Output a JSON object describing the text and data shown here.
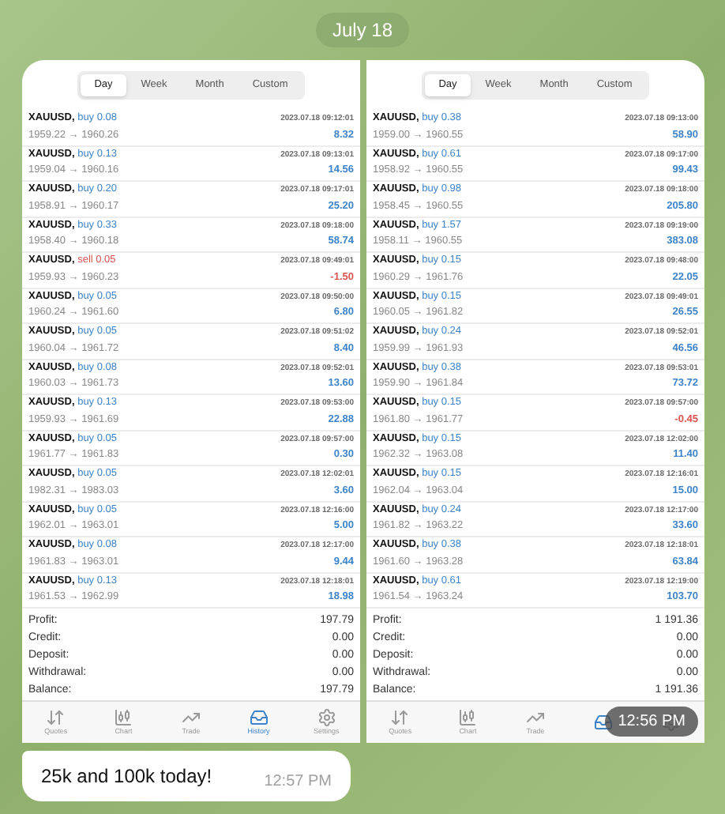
{
  "date_label": "July 18",
  "screenshots": [
    {
      "segments": [
        {
          "label": "Day",
          "selected": true
        },
        {
          "label": "Week",
          "selected": false
        },
        {
          "label": "Month",
          "selected": false
        },
        {
          "label": "Custom",
          "selected": false
        }
      ],
      "trades": [
        {
          "symbol": "XAUUSD,",
          "kind": "buy",
          "order": "buy 0.08",
          "time": "2023.07.18 09:12:01",
          "prices": "1959.22 → 1960.26",
          "profit": "8.32",
          "loss": false
        },
        {
          "symbol": "XAUUSD,",
          "kind": "buy",
          "order": "buy 0.13",
          "time": "2023.07.18 09:13:01",
          "prices": "1959.04 → 1960.16",
          "profit": "14.56",
          "loss": false
        },
        {
          "symbol": "XAUUSD,",
          "kind": "buy",
          "order": "buy 0.20",
          "time": "2023.07.18 09:17:01",
          "prices": "1958.91 → 1960.17",
          "profit": "25.20",
          "loss": false
        },
        {
          "symbol": "XAUUSD,",
          "kind": "buy",
          "order": "buy 0.33",
          "time": "2023.07.18 09:18:00",
          "prices": "1958.40 → 1960.18",
          "profit": "58.74",
          "loss": false
        },
        {
          "symbol": "XAUUSD,",
          "kind": "sell",
          "order": "sell 0.05",
          "time": "2023.07.18 09:49:01",
          "prices": "1959.93 → 1960.23",
          "profit": "-1.50",
          "loss": true
        },
        {
          "symbol": "XAUUSD,",
          "kind": "buy",
          "order": "buy 0.05",
          "time": "2023.07.18 09:50:00",
          "prices": "1960.24 → 1961.60",
          "profit": "6.80",
          "loss": false
        },
        {
          "symbol": "XAUUSD,",
          "kind": "buy",
          "order": "buy 0.05",
          "time": "2023.07.18 09:51:02",
          "prices": "1960.04 → 1961.72",
          "profit": "8.40",
          "loss": false
        },
        {
          "symbol": "XAUUSD,",
          "kind": "buy",
          "order": "buy 0.08",
          "time": "2023.07.18 09:52:01",
          "prices": "1960.03 → 1961.73",
          "profit": "13.60",
          "loss": false
        },
        {
          "symbol": "XAUUSD,",
          "kind": "buy",
          "order": "buy 0.13",
          "time": "2023.07.18 09:53:00",
          "prices": "1959.93 → 1961.69",
          "profit": "22.88",
          "loss": false
        },
        {
          "symbol": "XAUUSD,",
          "kind": "buy",
          "order": "buy 0.05",
          "time": "2023.07.18 09:57:00",
          "prices": "1961.77 → 1961.83",
          "profit": "0.30",
          "loss": false
        },
        {
          "symbol": "XAUUSD,",
          "kind": "buy",
          "order": "buy 0.05",
          "time": "2023.07.18 12:02:01",
          "prices": "1982.31 → 1983.03",
          "profit": "3.60",
          "loss": false
        },
        {
          "symbol": "XAUUSD,",
          "kind": "buy",
          "order": "buy 0.05",
          "time": "2023.07.18 12:16:00",
          "prices": "1962.01 → 1963.01",
          "profit": "5.00",
          "loss": false
        },
        {
          "symbol": "XAUUSD,",
          "kind": "buy",
          "order": "buy 0.08",
          "time": "2023.07.18 12:17:00",
          "prices": "1961.83 → 1963.01",
          "profit": "9.44",
          "loss": false
        },
        {
          "symbol": "XAUUSD,",
          "kind": "buy",
          "order": "buy 0.13",
          "time": "2023.07.18 12:18:01",
          "prices": "1961.53 → 1962.99",
          "profit": "18.98",
          "loss": false
        }
      ],
      "summary": [
        {
          "label": "Profit:",
          "value": "197.79"
        },
        {
          "label": "Credit:",
          "value": "0.00"
        },
        {
          "label": "Deposit:",
          "value": "0.00"
        },
        {
          "label": "Withdrawal:",
          "value": "0.00"
        },
        {
          "label": "Balance:",
          "value": "197.79"
        }
      ],
      "tabs": [
        {
          "label": "Quotes",
          "selected": false
        },
        {
          "label": "Chart",
          "selected": false
        },
        {
          "label": "Trade",
          "selected": false
        },
        {
          "label": "History",
          "selected": true
        },
        {
          "label": "Settings",
          "selected": false
        }
      ]
    },
    {
      "segments": [
        {
          "label": "Day",
          "selected": true
        },
        {
          "label": "Week",
          "selected": false
        },
        {
          "label": "Month",
          "selected": false
        },
        {
          "label": "Custom",
          "selected": false
        }
      ],
      "trades": [
        {
          "symbol": "XAUUSD,",
          "kind": "buy",
          "order": "buy 0.38",
          "time": "2023.07.18 09:13:00",
          "prices": "1959.00 → 1960.55",
          "profit": "58.90",
          "loss": false
        },
        {
          "symbol": "XAUUSD,",
          "kind": "buy",
          "order": "buy 0.61",
          "time": "2023.07.18 09:17:00",
          "prices": "1958.92 → 1960.55",
          "profit": "99.43",
          "loss": false
        },
        {
          "symbol": "XAUUSD,",
          "kind": "buy",
          "order": "buy 0.98",
          "time": "2023.07.18 09:18:00",
          "prices": "1958.45 → 1960.55",
          "profit": "205.80",
          "loss": false
        },
        {
          "symbol": "XAUUSD,",
          "kind": "buy",
          "order": "buy 1.57",
          "time": "2023.07.18 09:19:00",
          "prices": "1958.11 → 1960.55",
          "profit": "383.08",
          "loss": false
        },
        {
          "symbol": "XAUUSD,",
          "kind": "buy",
          "order": "buy 0.15",
          "time": "2023.07.18 09:48:00",
          "prices": "1960.29 → 1961.76",
          "profit": "22.05",
          "loss": false
        },
        {
          "symbol": "XAUUSD,",
          "kind": "buy",
          "order": "buy 0.15",
          "time": "2023.07.18 09:49:01",
          "prices": "1960.05 → 1961.82",
          "profit": "26.55",
          "loss": false
        },
        {
          "symbol": "XAUUSD,",
          "kind": "buy",
          "order": "buy 0.24",
          "time": "2023.07.18 09:52:01",
          "prices": "1959.99 → 1961.93",
          "profit": "46.56",
          "loss": false
        },
        {
          "symbol": "XAUUSD,",
          "kind": "buy",
          "order": "buy 0.38",
          "time": "2023.07.18 09:53:01",
          "prices": "1959.90 → 1961.84",
          "profit": "73.72",
          "loss": false
        },
        {
          "symbol": "XAUUSD,",
          "kind": "buy",
          "order": "buy 0.15",
          "time": "2023.07.18 09:57:00",
          "prices": "1961.80 → 1961.77",
          "profit": "-0.45",
          "loss": true
        },
        {
          "symbol": "XAUUSD,",
          "kind": "buy",
          "order": "buy 0.15",
          "time": "2023.07.18 12:02:00",
          "prices": "1962.32 → 1963.08",
          "profit": "11.40",
          "loss": false
        },
        {
          "symbol": "XAUUSD,",
          "kind": "buy",
          "order": "buy 0.15",
          "time": "2023.07.18 12:16:01",
          "prices": "1962.04 → 1963.04",
          "profit": "15.00",
          "loss": false
        },
        {
          "symbol": "XAUUSD,",
          "kind": "buy",
          "order": "buy 0.24",
          "time": "2023.07.18 12:17:00",
          "prices": "1961.82 → 1963.22",
          "profit": "33.60",
          "loss": false
        },
        {
          "symbol": "XAUUSD,",
          "kind": "buy",
          "order": "buy 0.38",
          "time": "2023.07.18 12:18:01",
          "prices": "1961.60 → 1963.28",
          "profit": "63.84",
          "loss": false
        },
        {
          "symbol": "XAUUSD,",
          "kind": "buy",
          "order": "buy 0.61",
          "time": "2023.07.18 12:19:00",
          "prices": "1961.54 → 1963.24",
          "profit": "103.70",
          "loss": false
        }
      ],
      "summary": [
        {
          "label": "Profit:",
          "value": "1 191.36"
        },
        {
          "label": "Credit:",
          "value": "0.00"
        },
        {
          "label": "Deposit:",
          "value": "0.00"
        },
        {
          "label": "Withdrawal:",
          "value": "0.00"
        },
        {
          "label": "Balance:",
          "value": "1 191.36"
        }
      ],
      "tabs": [
        {
          "label": "Quotes",
          "selected": false
        },
        {
          "label": "Chart",
          "selected": false
        },
        {
          "label": "Trade",
          "selected": false
        },
        {
          "selected": true
        },
        {
          "selected": false
        }
      ],
      "timestamp": "12:56 PM"
    }
  ],
  "message": {
    "text": "25k and 100k today!",
    "time": "12:57 PM"
  }
}
